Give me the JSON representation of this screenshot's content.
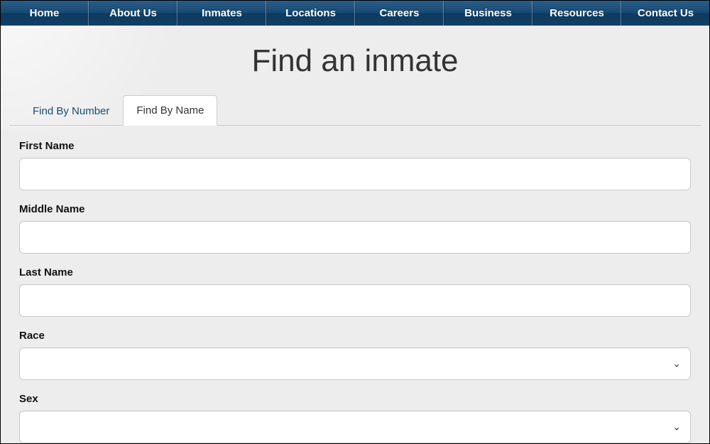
{
  "nav": {
    "items": [
      "Home",
      "About Us",
      "Inmates",
      "Locations",
      "Careers",
      "Business",
      "Resources",
      "Contact Us"
    ]
  },
  "page": {
    "title": "Find an inmate"
  },
  "tabs": {
    "by_number": "Find By Number",
    "by_name": "Find By Name"
  },
  "form": {
    "first_name": {
      "label": "First Name",
      "value": ""
    },
    "middle_name": {
      "label": "Middle Name",
      "value": ""
    },
    "last_name": {
      "label": "Last Name",
      "value": ""
    },
    "race": {
      "label": "Race",
      "selected": ""
    },
    "sex": {
      "label": "Sex",
      "selected": ""
    }
  }
}
